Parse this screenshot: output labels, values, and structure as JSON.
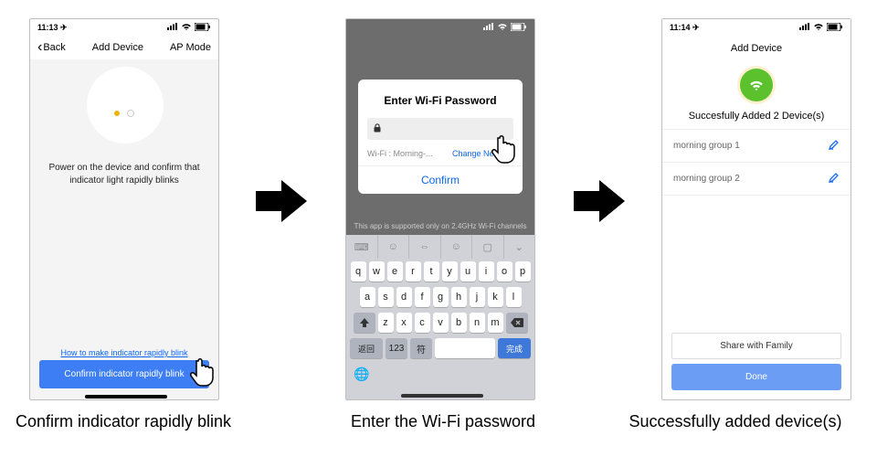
{
  "status": {
    "time1": "11:13 ✈",
    "time3": "11:14 ✈"
  },
  "phone1": {
    "back": "Back",
    "title": "Add Device",
    "apmode": "AP Mode",
    "msg": "Power on the device and confirm that indicator light rapidly blinks",
    "help": "How to make indicator rapidly blink",
    "confirm": "Confirm indicator rapidly blink"
  },
  "phone2": {
    "dialog_title": "Enter Wi-Fi Password",
    "wifi_label": "Wi-Fi : Morning-...",
    "change": "Change Network",
    "confirm": "Confirm",
    "note": "This app is supported only on 2.4GHz Wi-Fi channels",
    "keys_row1": [
      "q",
      "w",
      "e",
      "r",
      "t",
      "y",
      "u",
      "i",
      "o",
      "p"
    ],
    "keys_row2": [
      "a",
      "s",
      "d",
      "f",
      "g",
      "h",
      "j",
      "k",
      "l"
    ],
    "keys_row3": [
      "z",
      "x",
      "c",
      "v",
      "b",
      "n",
      "m"
    ],
    "key_back": "返回",
    "key_123": "123",
    "key_fu": "符",
    "key_done": "完成"
  },
  "phone3": {
    "title": "Add Device",
    "success": "Succesfully Added 2 Device(s)",
    "items": [
      "morning group 1",
      "morning group 2"
    ],
    "share": "Share with Family",
    "done": "Done"
  },
  "captions": {
    "c1": "Confirm indicator rapidly blink",
    "c2": "Enter the Wi-Fi password",
    "c3": "Successfully added device(s)"
  }
}
